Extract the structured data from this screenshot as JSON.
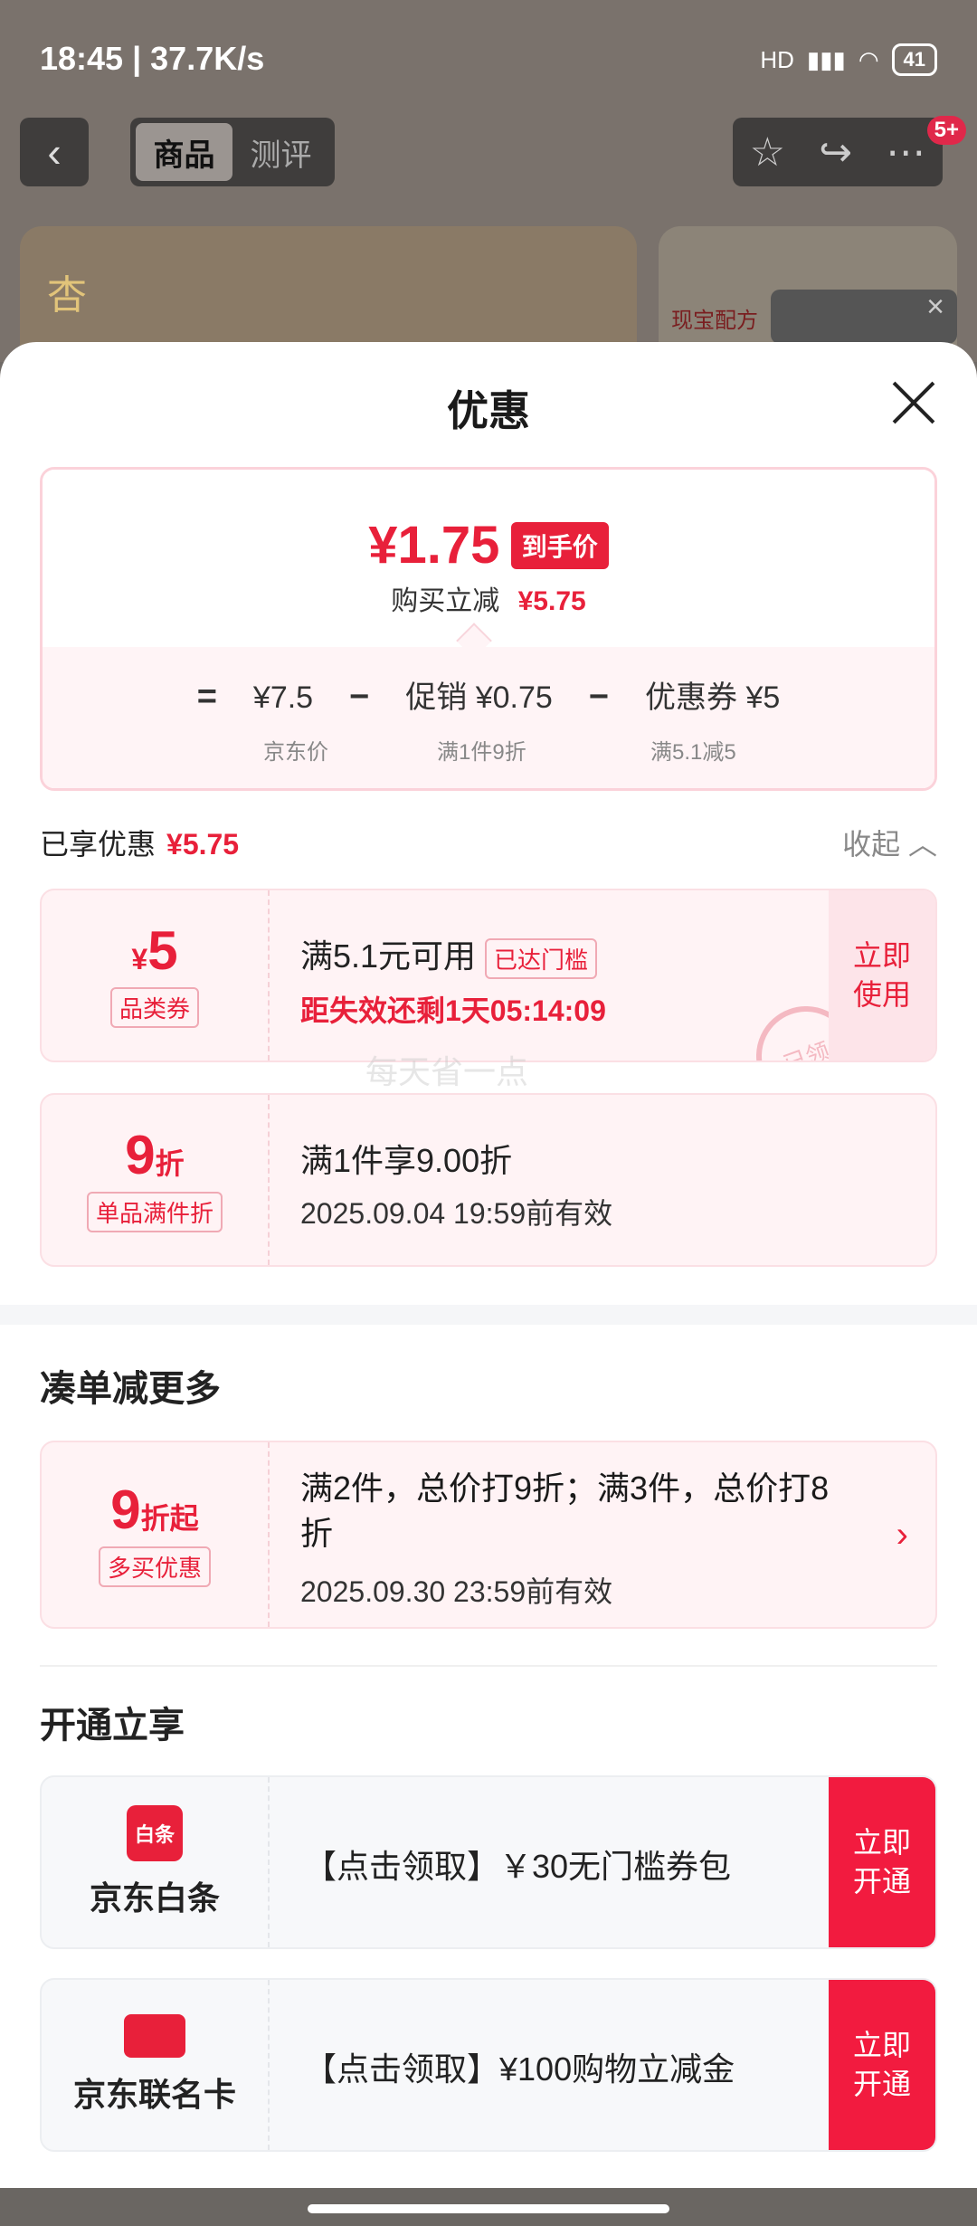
{
  "status": {
    "time_speed": "18:45 | 37.7K/s",
    "network": "HD",
    "battery": "41"
  },
  "topbar": {
    "back": "‹",
    "tabs": [
      "商品",
      "测评"
    ],
    "badge": "5+"
  },
  "background": {
    "product_label": "现宝配方",
    "product_char": "杏"
  },
  "sheet": {
    "title": "优惠",
    "price": {
      "value": "¥1.75",
      "tag": "到手价",
      "sub_label": "购买立减",
      "sub_value": "¥5.75"
    },
    "calc": {
      "eq": "=",
      "jd_price": "¥7.5",
      "minus": "−",
      "promo": "促销 ¥0.75",
      "coupon": "优惠券 ¥5",
      "notes": [
        "京东价",
        "满1件9折",
        "满5.1减5"
      ]
    },
    "enjoyed": {
      "label": "已享优惠",
      "value": "¥5.75",
      "collapse": "收起"
    },
    "coupons": [
      {
        "amount_prefix": "¥",
        "amount": "5",
        "type": "品类券",
        "line1": "满5.1元可用",
        "reach": "已达门槛",
        "line2": "距失效还剩1天05:14:09",
        "btn": "立即\n使用",
        "stamp": "已领"
      },
      {
        "amount": "9",
        "amount_suffix": "折",
        "type": "单品满件折",
        "line1": "满1件享9.00折",
        "line2": "2025.09.04 19:59前有效"
      }
    ],
    "watermark": "每天省一点",
    "more_section": {
      "title": "凑单减更多",
      "amount": "9",
      "amount_suffix": "折起",
      "type": "多买优惠",
      "text": "满2件，总价打9折；满3件，总价打8折",
      "date": "2025.09.30 23:59前有效",
      "chevron": "›"
    },
    "open_section": {
      "title": "开通立享",
      "cards": [
        {
          "logo": "白条",
          "name": "京东白条",
          "text": "【点击领取】￥30无门槛券包",
          "btn": "立即\n开通"
        },
        {
          "logo": "",
          "name": "京东联名卡",
          "text": "【点击领取】¥100购物立减金",
          "btn": "立即\n开通"
        }
      ]
    }
  },
  "colors": {
    "accent": "#e8203a",
    "button": "#f21b3f",
    "pink_bg": "#fff3f5"
  }
}
